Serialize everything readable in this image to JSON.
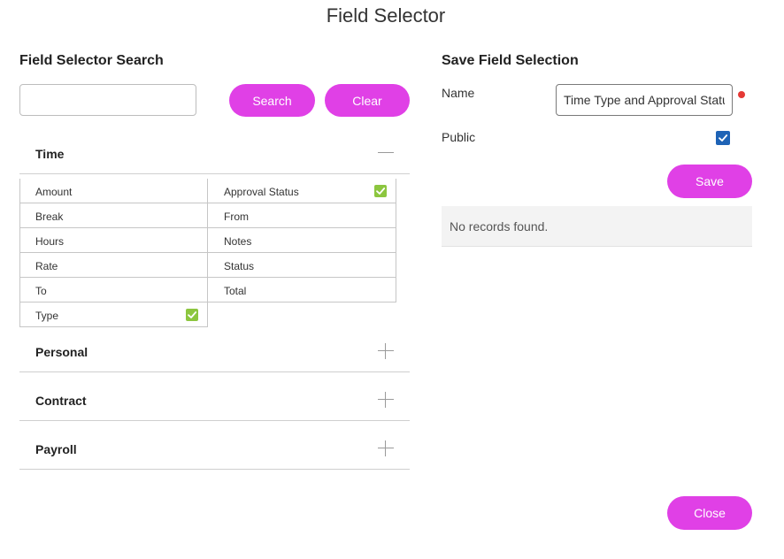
{
  "dialog": {
    "title": "Field Selector"
  },
  "search": {
    "heading": "Field Selector Search",
    "input_value": "",
    "search_label": "Search",
    "clear_label": "Clear"
  },
  "groups": {
    "time": {
      "title": "Time",
      "expanded": true,
      "fields": [
        {
          "label": "Amount",
          "checked": false
        },
        {
          "label": "Approval Status",
          "checked": true
        },
        {
          "label": "Break",
          "checked": false
        },
        {
          "label": "From",
          "checked": false
        },
        {
          "label": "Hours",
          "checked": false
        },
        {
          "label": "Notes",
          "checked": false
        },
        {
          "label": "Rate",
          "checked": false
        },
        {
          "label": "Status",
          "checked": false
        },
        {
          "label": "To",
          "checked": false
        },
        {
          "label": "Total",
          "checked": false
        },
        {
          "label": "Type",
          "checked": true
        }
      ]
    },
    "personal": {
      "title": "Personal",
      "expanded": false
    },
    "contract": {
      "title": "Contract",
      "expanded": false
    },
    "payroll": {
      "title": "Payroll",
      "expanded": false
    }
  },
  "save": {
    "heading": "Save Field Selection",
    "name_label": "Name",
    "name_value": "Time Type and Approval Status",
    "public_label": "Public",
    "public_checked": true,
    "save_label": "Save",
    "empty_message": "No records found."
  },
  "footer": {
    "close_label": "Close"
  },
  "colors": {
    "accent": "#e040e6",
    "checked_field": "#8cc63f",
    "public_checkbox": "#1e63b6",
    "required": "#e53935"
  }
}
